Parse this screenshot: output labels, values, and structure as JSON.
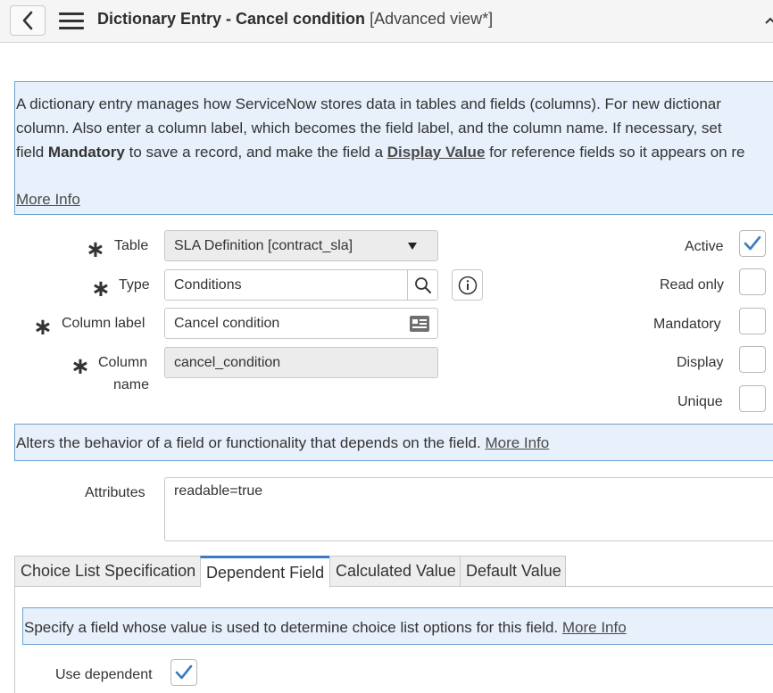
{
  "header": {
    "title_main": "Dictionary Entry - Cancel condition",
    "title_view": "[Advanced view*]"
  },
  "intro": {
    "line1": "A dictionary entry manages how ServiceNow stores data in tables and fields (columns). For new dictionar",
    "line2": "column. Also enter a column label, which becomes the field label, and the column name. If necessary, set",
    "line3_a": "field ",
    "line3_b": "Mandatory",
    "line3_c": " to save a record, and make the field a ",
    "line3_d": "Display Value",
    "line3_e": " for reference fields so it appears on re",
    "more_info": "More Info"
  },
  "form": {
    "table_label": "Table",
    "table_value": "SLA Definition [contract_sla]",
    "type_label": "Type",
    "type_value": "Conditions",
    "column_label_label": "Column label",
    "column_label_value": "Cancel condition",
    "column_name_label_1": "Column",
    "column_name_label_2": "name",
    "column_name_value": "cancel_condition",
    "required_mark": "∗"
  },
  "checkboxes": {
    "active_label": "Active",
    "active_checked": true,
    "read_only_label": "Read only",
    "mandatory_label": "Mandatory",
    "display_label": "Display",
    "unique_label": "Unique"
  },
  "attributes_info": {
    "text": "Alters the behavior of a field or functionality that depends on the field. ",
    "more_info": "More Info"
  },
  "attributes": {
    "label": "Attributes",
    "value": "readable=true"
  },
  "tabs": [
    {
      "label": "Choice List Specification",
      "active": false
    },
    {
      "label": "Dependent Field",
      "active": true
    },
    {
      "label": "Calculated Value",
      "active": false
    },
    {
      "label": "Default Value",
      "active": false
    }
  ],
  "dependent": {
    "info_text": "Specify a field whose value is used to determine choice list options for this field. ",
    "more_info": "More Info",
    "use_dependent_label": "Use dependent",
    "use_dependent_checked": true
  },
  "colors": {
    "accent": "#3b7bbf",
    "info_bg": "#e7f0fb",
    "info_border": "#6da2d3"
  }
}
